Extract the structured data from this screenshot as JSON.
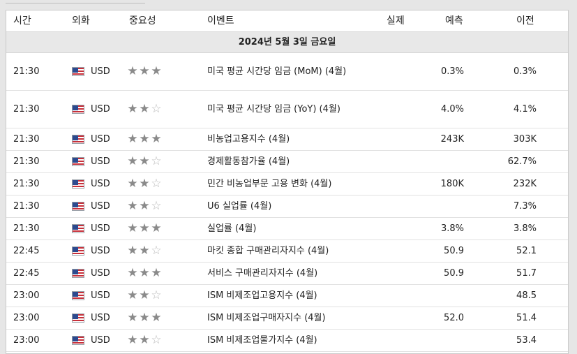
{
  "headers": {
    "time": "시간",
    "currency": "외화",
    "importance": "중요성",
    "event": "이벤트",
    "actual": "실제",
    "forecast": "예측",
    "previous": "이전"
  },
  "date_label": "2024년 5월 3일 금요일",
  "icons": {
    "flag": "us-flag-icon",
    "star_filled": "star-filled-icon",
    "star_empty": "star-empty-icon"
  },
  "events": [
    {
      "time": "21:30",
      "currency": "USD",
      "importance": 3,
      "event": "미국 평균 시간당 임금 (MoM) (4월)",
      "actual": "",
      "forecast": "0.3%",
      "previous": "0.3%"
    },
    {
      "time": "21:30",
      "currency": "USD",
      "importance": 2,
      "event": "미국 평균 시간당 임금 (YoY) (4월)",
      "actual": "",
      "forecast": "4.0%",
      "previous": "4.1%"
    },
    {
      "time": "21:30",
      "currency": "USD",
      "importance": 3,
      "event": "비농업고용지수 (4월)",
      "actual": "",
      "forecast": "243K",
      "previous": "303K"
    },
    {
      "time": "21:30",
      "currency": "USD",
      "importance": 2,
      "event": "경제활동참가율 (4월)",
      "actual": "",
      "forecast": "",
      "previous": "62.7%"
    },
    {
      "time": "21:30",
      "currency": "USD",
      "importance": 2,
      "event": "민간 비농업부문 고용 변화 (4월)",
      "actual": "",
      "forecast": "180K",
      "previous": "232K"
    },
    {
      "time": "21:30",
      "currency": "USD",
      "importance": 2,
      "event": "U6 실업률 (4월)",
      "actual": "",
      "forecast": "",
      "previous": "7.3%"
    },
    {
      "time": "21:30",
      "currency": "USD",
      "importance": 3,
      "event": "실업률 (4월)",
      "actual": "",
      "forecast": "3.8%",
      "previous": "3.8%"
    },
    {
      "time": "22:45",
      "currency": "USD",
      "importance": 2,
      "event": "마킷 종합 구매관리자지수 (4월)",
      "actual": "",
      "forecast": "50.9",
      "previous": "52.1"
    },
    {
      "time": "22:45",
      "currency": "USD",
      "importance": 3,
      "event": "서비스 구매관리자지수 (4월)",
      "actual": "",
      "forecast": "50.9",
      "previous": "51.7"
    },
    {
      "time": "23:00",
      "currency": "USD",
      "importance": 2,
      "event": "ISM 비제조업고용지수 (4월)",
      "actual": "",
      "forecast": "",
      "previous": "48.5"
    },
    {
      "time": "23:00",
      "currency": "USD",
      "importance": 3,
      "event": "ISM 비제조업구매자지수 (4월)",
      "actual": "",
      "forecast": "52.0",
      "previous": "51.4"
    },
    {
      "time": "23:00",
      "currency": "USD",
      "importance": 2,
      "event": "ISM 비제조업물가지수 (4월)",
      "actual": "",
      "forecast": "",
      "previous": "53.4"
    }
  ]
}
